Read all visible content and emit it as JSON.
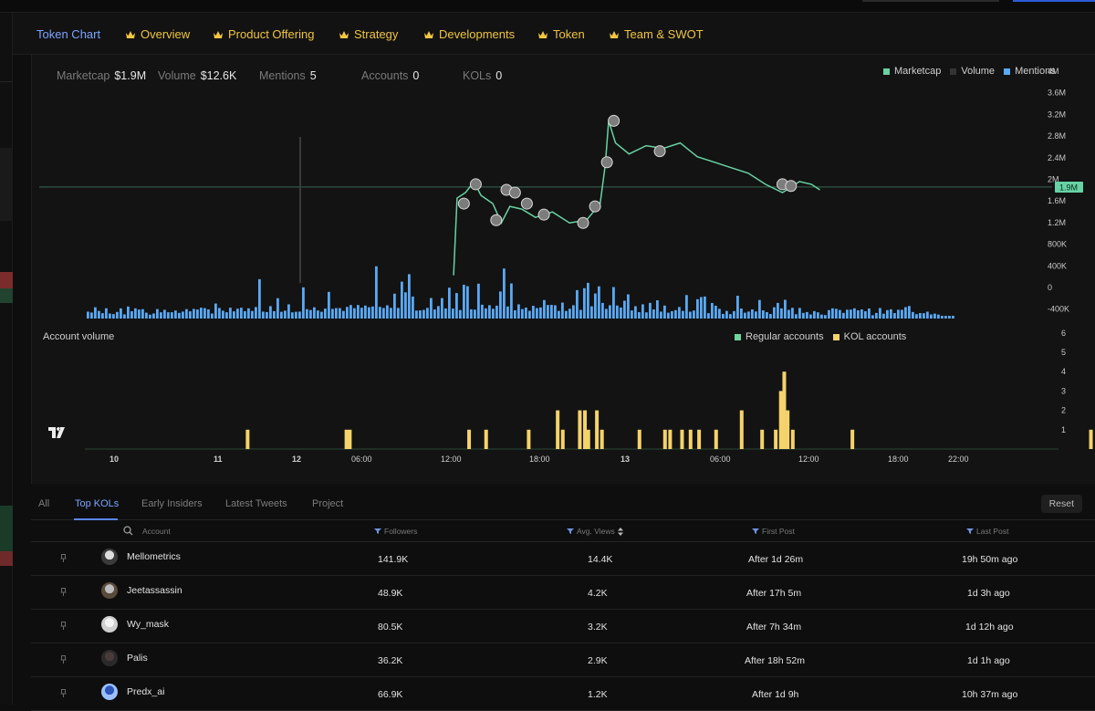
{
  "nav": {
    "items": [
      {
        "label": "Token Chart",
        "active": true
      },
      {
        "label": "Overview"
      },
      {
        "label": "Product Offering"
      },
      {
        "label": "Strategy"
      },
      {
        "label": "Developments"
      },
      {
        "label": "Token"
      },
      {
        "label": "Team & SWOT"
      }
    ]
  },
  "stats": {
    "marketcap_label": "Marketcap",
    "marketcap_value": "$1.9M",
    "volume_label": "Volume",
    "volume_value": "$12.6K",
    "mentions_label": "Mentions",
    "mentions_value": "5",
    "accounts_label": "Accounts",
    "accounts_value": "0",
    "kols_label": "KOLs",
    "kols_value": "0"
  },
  "price_legend": [
    "Marketcap",
    "Volume",
    "Mentions"
  ],
  "account_volume": {
    "title": "Account volume",
    "legend": [
      "Regular accounts",
      "KOL accounts"
    ]
  },
  "colors": {
    "marketcap": "#67d3a4",
    "mentions": "#5aa9f5",
    "kol": "#f4d36b",
    "regular": "#6fd69d",
    "accent": "#7aa4ff",
    "nav_gold": "#f0c541"
  },
  "chart_data": [
    {
      "type": "line",
      "title": "",
      "series": [
        {
          "name": "Marketcap",
          "values": [
            [
              12.02,
              0.3
            ],
            [
              12.04,
              1.7
            ],
            [
              12.09,
              1.8
            ],
            [
              12.14,
              2.0
            ],
            [
              12.18,
              1.75
            ],
            [
              12.25,
              1.6
            ],
            [
              12.3,
              1.25
            ],
            [
              12.35,
              1.55
            ],
            [
              12.42,
              1.5
            ],
            [
              12.5,
              1.35
            ],
            [
              12.6,
              1.45
            ],
            [
              12.7,
              1.25
            ],
            [
              12.8,
              1.3
            ],
            [
              12.88,
              1.6
            ],
            [
              12.91,
              2.3
            ],
            [
              12.93,
              3.1
            ],
            [
              12.97,
              2.7
            ],
            [
              13.05,
              2.5
            ],
            [
              13.15,
              2.65
            ],
            [
              13.25,
              2.6
            ],
            [
              13.35,
              2.7
            ],
            [
              13.45,
              2.45
            ],
            [
              13.55,
              2.35
            ],
            [
              13.65,
              2.25
            ],
            [
              13.75,
              2.15
            ],
            [
              13.85,
              1.95
            ],
            [
              13.95,
              1.8
            ],
            [
              14.05,
              2.0
            ],
            [
              14.12,
              1.95
            ],
            [
              14.17,
              1.85
            ]
          ]
        },
        {
          "name": "Mentions",
          "values": [
            [
              9.8,
              0.1
            ],
            [
              10.5,
              0.1
            ],
            [
              10.7,
              0.7
            ],
            [
              11.2,
              0.6
            ],
            [
              11.6,
              0.9
            ],
            [
              11.9,
              0.6
            ],
            [
              12.1,
              0.8
            ],
            [
              12.3,
              0.9
            ],
            [
              12.5,
              0.7
            ],
            [
              12.8,
              0.9
            ],
            [
              13.0,
              0.5
            ],
            [
              13.4,
              0.4
            ],
            [
              13.6,
              0.3
            ],
            [
              13.9,
              0.2
            ],
            [
              14.1,
              0.3
            ]
          ]
        }
      ],
      "y_axis_ticks": [
        "4M",
        "3.6M",
        "3.2M",
        "2.8M",
        "2.4M",
        "2M",
        "1.6M",
        "1.2M",
        "800K",
        "400K",
        "0",
        "-400K"
      ],
      "ylim": [
        -400000,
        4000000
      ],
      "current_value_label": "1.9M",
      "legend": [
        "Marketcap",
        "Volume",
        "Mentions"
      ],
      "legend_position": "top-right"
    },
    {
      "type": "bar",
      "title": "Account volume",
      "x_ticks": [
        "10",
        "11",
        "12",
        "06:00",
        "12:00",
        "18:00",
        "13",
        "06:00",
        "12:00",
        "18:00",
        "22:00"
      ],
      "series": [
        {
          "name": "KOL accounts",
          "values": [
            [
              10.8,
              1
            ],
            [
              11.38,
              1
            ],
            [
              11.4,
              1
            ],
            [
              12.1,
              1
            ],
            [
              12.2,
              1
            ],
            [
              12.45,
              1
            ],
            [
              12.62,
              2
            ],
            [
              12.65,
              1
            ],
            [
              12.75,
              2
            ],
            [
              12.78,
              2
            ],
            [
              12.8,
              1
            ],
            [
              12.85,
              2
            ],
            [
              12.88,
              1
            ],
            [
              13.1,
              1
            ],
            [
              13.25,
              1
            ],
            [
              13.28,
              1
            ],
            [
              13.35,
              1
            ],
            [
              13.4,
              1
            ],
            [
              13.45,
              1
            ],
            [
              13.55,
              1
            ],
            [
              13.7,
              2
            ],
            [
              13.82,
              1
            ],
            [
              13.9,
              1
            ],
            [
              13.93,
              3
            ],
            [
              13.95,
              4
            ],
            [
              13.97,
              2
            ],
            [
              14.0,
              1
            ],
            [
              14.35,
              1
            ],
            [
              15.75,
              1
            ],
            [
              15.85,
              2
            ]
          ]
        }
      ],
      "y_axis_ticks": [
        "6",
        "5",
        "4",
        "3",
        "2",
        "1"
      ],
      "ylim": [
        0,
        6
      ],
      "legend": [
        "Regular accounts",
        "KOL accounts"
      ],
      "legend_position": "top-right"
    }
  ],
  "tabs": {
    "items": [
      "All",
      "Top KOLs",
      "Early Insiders",
      "Latest Tweets",
      "Project"
    ],
    "active": "Top KOLs",
    "reset_label": "Reset"
  },
  "table": {
    "headers": {
      "account": "Account",
      "followers": "Followers",
      "avg_views": "Avg. Views",
      "first_post": "First Post",
      "last_post": "Last Post"
    },
    "rows": [
      {
        "account": "Mellometrics",
        "followers": "141.9K",
        "avg_views": "14.4K",
        "first_post": "After 1d 26m",
        "last_post": "19h 50m ago"
      },
      {
        "account": "Jeetassassin",
        "followers": "48.9K",
        "avg_views": "4.2K",
        "first_post": "After 17h 5m",
        "last_post": "1d 3h ago"
      },
      {
        "account": "Wy_mask",
        "followers": "80.5K",
        "avg_views": "3.2K",
        "first_post": "After 7h 34m",
        "last_post": "1d 12h ago"
      },
      {
        "account": "Palis",
        "followers": "36.2K",
        "avg_views": "2.9K",
        "first_post": "After 18h 52m",
        "last_post": "1d 1h ago"
      },
      {
        "account": "Predx_ai",
        "followers": "66.9K",
        "avg_views": "1.2K",
        "first_post": "After 1d 9h",
        "last_post": "10h 37m ago"
      }
    ]
  }
}
